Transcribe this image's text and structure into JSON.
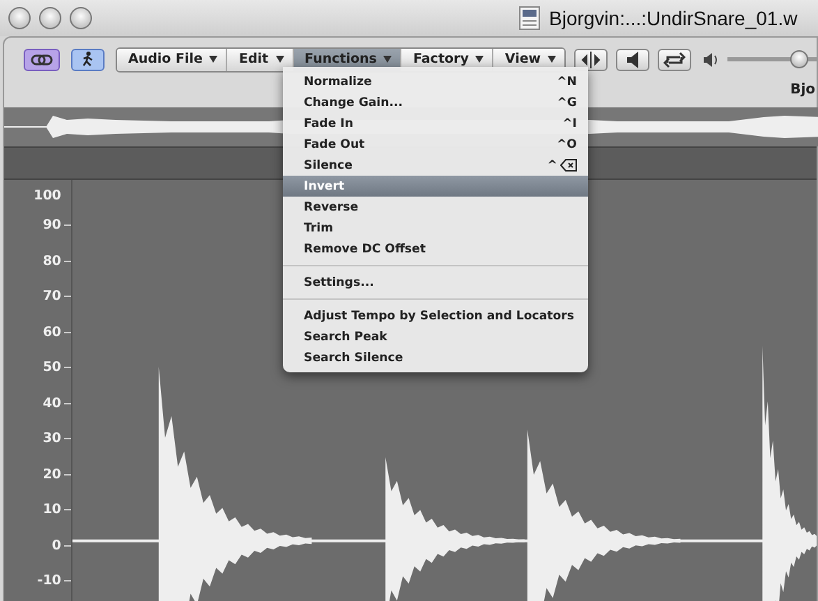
{
  "window": {
    "title": "Bjorgvin:...:UndirSnare_01.w"
  },
  "toolbar": {
    "link_on": true,
    "catch_on": true,
    "menus": [
      {
        "label": "Audio File",
        "selected": false
      },
      {
        "label": "Edit",
        "selected": false
      },
      {
        "label": "Functions",
        "selected": true
      },
      {
        "label": "Factory",
        "selected": false
      },
      {
        "label": "View",
        "selected": false
      }
    ],
    "volume": {
      "level": 0.8
    }
  },
  "file_label": "Bjo",
  "functions_menu": [
    {
      "kind": "item",
      "label": "Normalize",
      "shortcut": "^N",
      "selected": false
    },
    {
      "kind": "item",
      "label": "Change Gain...",
      "shortcut": "^G",
      "selected": false
    },
    {
      "kind": "item",
      "label": "Fade In",
      "shortcut": "^I",
      "selected": false
    },
    {
      "kind": "item",
      "label": "Fade Out",
      "shortcut": "^O",
      "selected": false
    },
    {
      "kind": "item",
      "label": "Silence",
      "shortcut": "^",
      "delete_key": true,
      "selected": false
    },
    {
      "kind": "item",
      "label": "Invert",
      "selected": true
    },
    {
      "kind": "item",
      "label": "Reverse",
      "selected": false
    },
    {
      "kind": "item",
      "label": "Trim",
      "selected": false
    },
    {
      "kind": "item",
      "label": "Remove DC Offset",
      "selected": false
    },
    {
      "kind": "separator"
    },
    {
      "kind": "item",
      "label": "Settings...",
      "selected": false
    },
    {
      "kind": "separator"
    },
    {
      "kind": "item",
      "label": "Adjust Tempo by Selection and Locators",
      "selected": false
    },
    {
      "kind": "item",
      "label": "Search Peak",
      "selected": false
    },
    {
      "kind": "item",
      "label": "Search Silence",
      "selected": false
    }
  ],
  "amplitude_labels": [
    "100",
    "90",
    "80",
    "70",
    "60",
    "50",
    "40",
    "30",
    "20",
    "10",
    "0",
    "-10"
  ]
}
